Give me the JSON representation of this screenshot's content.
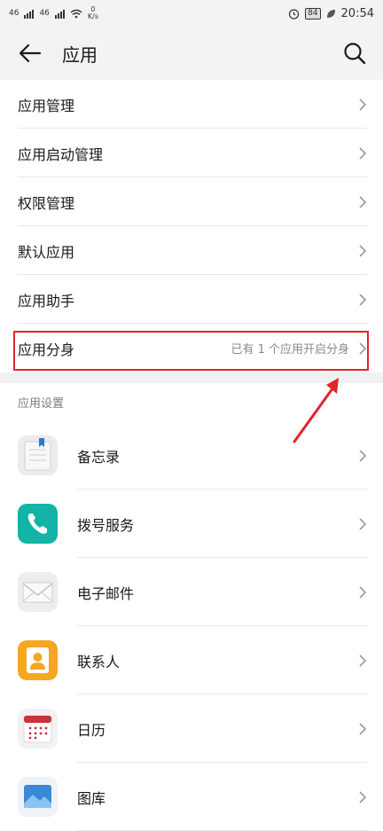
{
  "status": {
    "signal1": "46",
    "signal2": "46",
    "speed_value": "0",
    "speed_unit": "K/s",
    "battery": "84",
    "time": "20:54"
  },
  "header": {
    "title": "应用"
  },
  "menu": [
    {
      "label": "应用管理"
    },
    {
      "label": "应用启动管理"
    },
    {
      "label": "权限管理"
    },
    {
      "label": "默认应用"
    },
    {
      "label": "应用助手"
    },
    {
      "label": "应用分身",
      "sub": "已有 1 个应用开启分身"
    }
  ],
  "section_title": "应用设置",
  "apps": [
    {
      "label": "备忘录",
      "icon": "notepad-icon"
    },
    {
      "label": "拨号服务",
      "icon": "phone-icon"
    },
    {
      "label": "电子邮件",
      "icon": "email-icon"
    },
    {
      "label": "联系人",
      "icon": "contacts-icon"
    },
    {
      "label": "日历",
      "icon": "calendar-icon"
    },
    {
      "label": "图库",
      "icon": "gallery-icon"
    }
  ],
  "colors": {
    "highlight": "#e0252b",
    "phone_teal": "#13b3a8",
    "contacts_orange": "#f5a623",
    "calendar_red": "#c8333a"
  }
}
